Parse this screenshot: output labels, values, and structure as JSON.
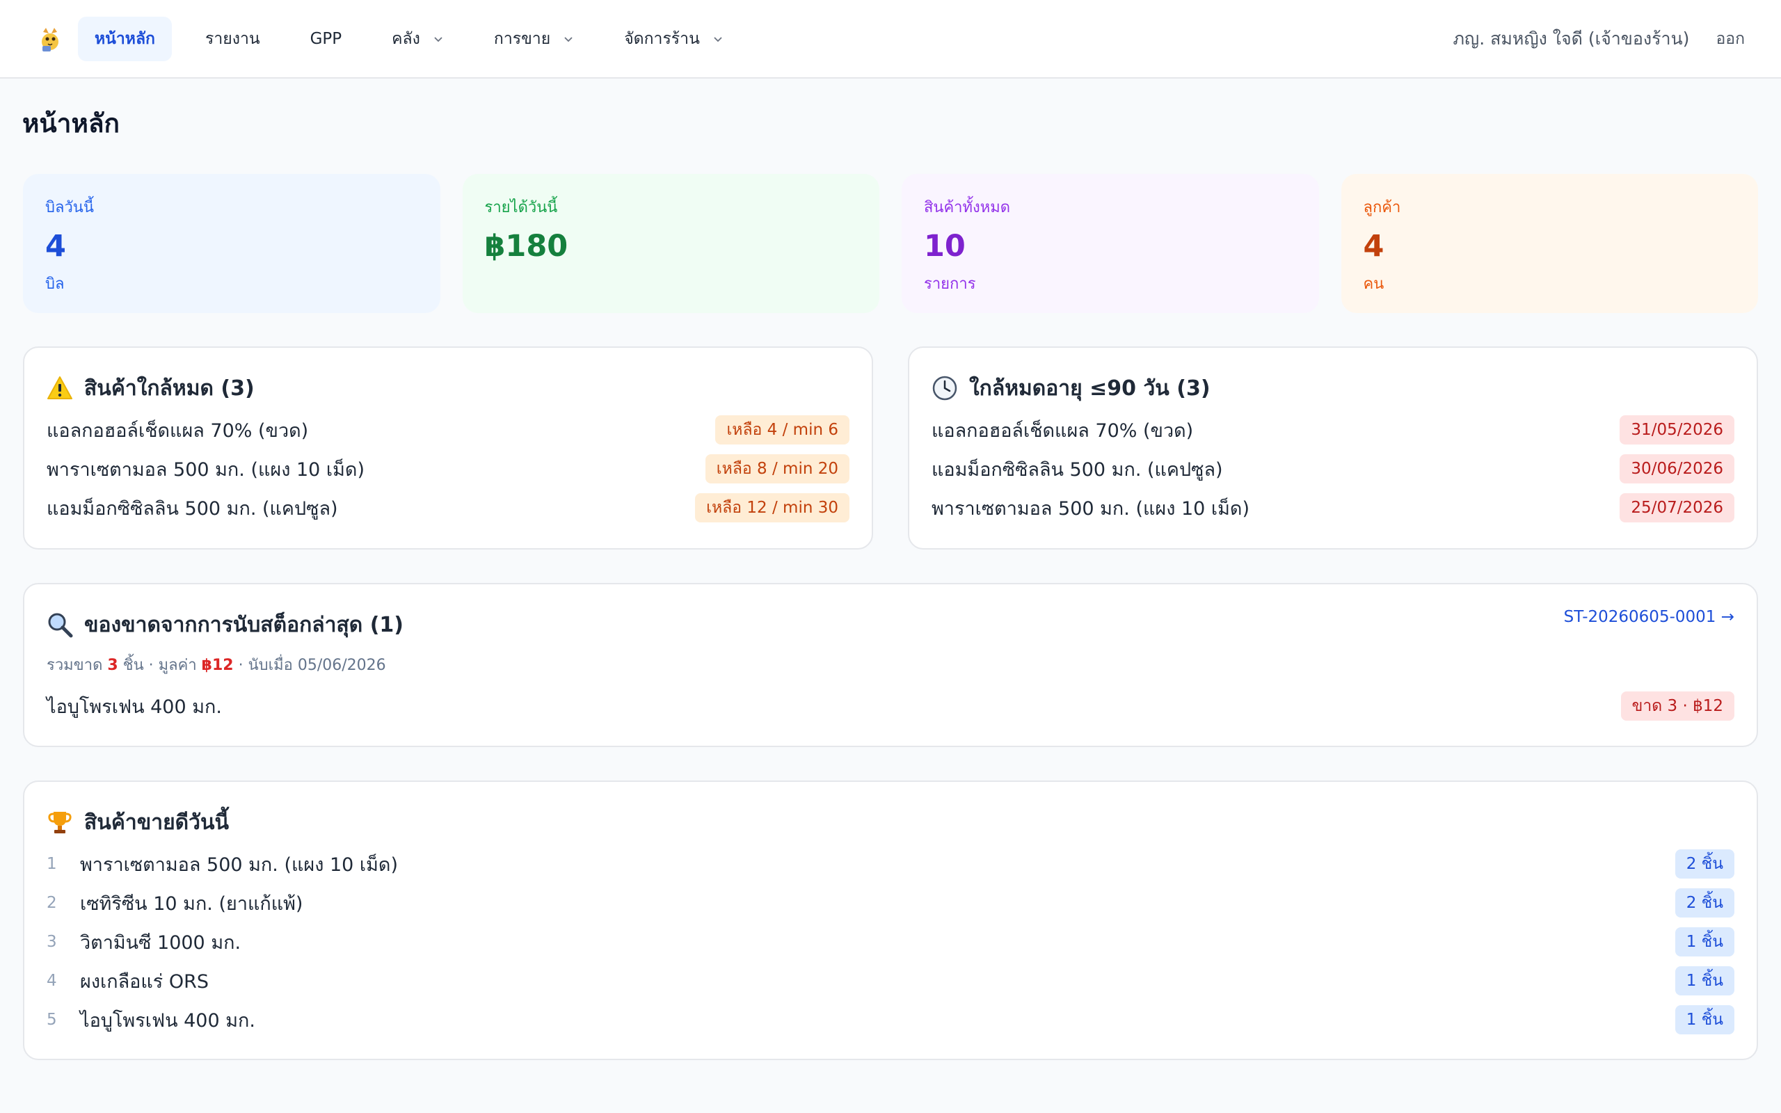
{
  "nav": {
    "items": [
      {
        "label": "หน้าหลัก",
        "active": true
      },
      {
        "label": "รายงาน"
      },
      {
        "label": "GPP"
      },
      {
        "label": "คลัง",
        "dropdown": true
      },
      {
        "label": "การขาย",
        "dropdown": true
      },
      {
        "label": "จัดการร้าน",
        "dropdown": true
      }
    ],
    "user": "ภญ. สมหญิง ใจดี (เจ้าของร้าน)",
    "logout": "ออก"
  },
  "page_title": "หน้าหลัก",
  "stats": [
    {
      "label": "บิลวันนี้",
      "value": "4",
      "unit": "บิล",
      "bg": "#eff6ff",
      "color": "#1d4ed8",
      "labelColor": "#2563eb"
    },
    {
      "label": "รายได้วันนี้",
      "value": "฿180",
      "unit": "",
      "bg": "#f0fdf4",
      "color": "#15803d",
      "labelColor": "#16a34a"
    },
    {
      "label": "สินค้าทั้งหมด",
      "value": "10",
      "unit": "รายการ",
      "bg": "#faf5ff",
      "color": "#7e22ce",
      "labelColor": "#9333ea"
    },
    {
      "label": "ลูกค้า",
      "value": "4",
      "unit": "คน",
      "bg": "#fff7ed",
      "color": "#c2410c",
      "labelColor": "#ea580c"
    }
  ],
  "low_stock": {
    "title": "สินค้าใกล้หมด (3)",
    "items": [
      {
        "name": "แอลกอฮอล์เช็ดแผล 70% (ขวด)",
        "badge": "เหลือ 4 / min 6"
      },
      {
        "name": "พาราเซตามอล 500 มก. (แผง 10 เม็ด)",
        "badge": "เหลือ 8 / min 20"
      },
      {
        "name": "แอมม็อกซิซิลลิน 500 มก. (แคปซูล)",
        "badge": "เหลือ 12 / min 30"
      }
    ]
  },
  "expiry": {
    "title": "ใกล้หมดอายุ ≤90 วัน (3)",
    "items": [
      {
        "name": "แอลกอฮอล์เช็ดแผล 70% (ขวด)",
        "badge": "31/05/2026"
      },
      {
        "name": "แอมม็อกซิซิลลิน 500 มก. (แคปซูล)",
        "badge": "30/06/2026"
      },
      {
        "name": "พาราเซตามอล 500 มก. (แผง 10 เม็ด)",
        "badge": "25/07/2026"
      }
    ]
  },
  "stock_count": {
    "title": "ของขาดจากการนับสต็อกล่าสุด (1)",
    "link": "ST-20260605-0001 →",
    "summary_prefix": "รวมขาด ",
    "summary_qty": "3",
    "summary_mid": " ชิ้น · มูลค่า ",
    "summary_value": "฿12",
    "summary_suffix": " · นับเมื่อ 05/06/2026",
    "items": [
      {
        "name": "ไอบูโพรเฟน 400 มก.",
        "badge": "ขาด 3 · ฿12"
      }
    ]
  },
  "best_sellers": {
    "title": "สินค้าขายดีวันนี้",
    "items": [
      {
        "rank": "1",
        "name": "พาราเซตามอล 500 มก. (แผง 10 เม็ด)",
        "badge": "2 ชิ้น"
      },
      {
        "rank": "2",
        "name": "เซทิริซีน 10 มก. (ยาแก้แพ้)",
        "badge": "2 ชิ้น"
      },
      {
        "rank": "3",
        "name": "วิตามินซี 1000 มก.",
        "badge": "1 ชิ้น"
      },
      {
        "rank": "4",
        "name": "ผงเกลือแร่ ORS",
        "badge": "1 ชิ้น"
      },
      {
        "rank": "5",
        "name": "ไอบูโพรเฟน 400 มก.",
        "badge": "1 ชิ้น"
      }
    ]
  },
  "icons": {
    "logo": "pharmacy-mascot-logo",
    "low_stock": "warning-icon",
    "expiry": "clock-icon",
    "stock_count": "magnifier-icon",
    "best_sellers": "trophy-icon"
  }
}
